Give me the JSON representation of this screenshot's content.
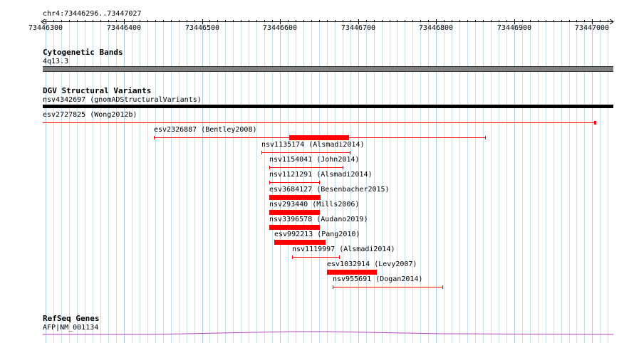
{
  "ruler": {
    "location": "chr4:73446296..73447027",
    "start": 73446296,
    "end": 73447027,
    "tick_labels": [
      "73446300",
      "73446400",
      "73446500",
      "73446600",
      "73446700",
      "73446800",
      "73446900",
      "73447000"
    ]
  },
  "tracks": {
    "cytoband": {
      "title": "Cytogenetic Bands",
      "band_label": "4q13.3",
      "band_color": "#808080"
    },
    "dgv": {
      "title": "DGV Structural Variants",
      "color": "#ff0000",
      "features": [
        {
          "label": "nsv4342697 (gnomADStructuralVariants)",
          "start": 73446296,
          "end": 73447027,
          "color": "#000000",
          "style": "black-bar"
        },
        {
          "label": "esv2727825 (Wong2012b)",
          "start": 73446296,
          "end": 73447003,
          "style": "line-right-cap"
        },
        {
          "label": "esv2326887 (Bentley2008)",
          "start": 73446438,
          "end": 73446863,
          "thick_start": 73446612,
          "thick_end": 73446688,
          "style": "line-caps-thick"
        },
        {
          "label": "nsv1135174 (Alsmadi2014)",
          "start": 73446576,
          "end": 73446689,
          "style": "line-caps"
        },
        {
          "label": "nsv1154041 (John2014)",
          "start": 73446586,
          "end": 73446680,
          "style": "line-caps"
        },
        {
          "label": "nsv1121291 (Alsmadi2014)",
          "start": 73446586,
          "end": 73446650,
          "style": "line-caps"
        },
        {
          "label": "esv3684127 (Besenbacher2015)",
          "start": 73446586,
          "end": 73446652,
          "style": "thick"
        },
        {
          "label": "nsv293440 (Mills2006)",
          "start": 73446586,
          "end": 73446651,
          "style": "thick"
        },
        {
          "label": "nsv3396578 (Audano2019)",
          "start": 73446586,
          "end": 73446651,
          "style": "thick"
        },
        {
          "label": "esv992213 (Pang2010)",
          "start": 73446593,
          "end": 73446658,
          "style": "thick"
        },
        {
          "label": "nsv1119997 (Alsmadi2014)",
          "start": 73446615,
          "end": 73446676,
          "style": "line-caps"
        },
        {
          "label": "esv1032914 (Levy2007)",
          "start": 73446660,
          "end": 73446724,
          "style": "thick"
        },
        {
          "label": "nsv955691 (Dogan2014)",
          "start": 73446667,
          "end": 73446808,
          "style": "line-caps"
        }
      ]
    },
    "refseq": {
      "title": "RefSeq Genes",
      "gene_label": "AFP|NM_001134",
      "color": "#bb44bb"
    }
  }
}
